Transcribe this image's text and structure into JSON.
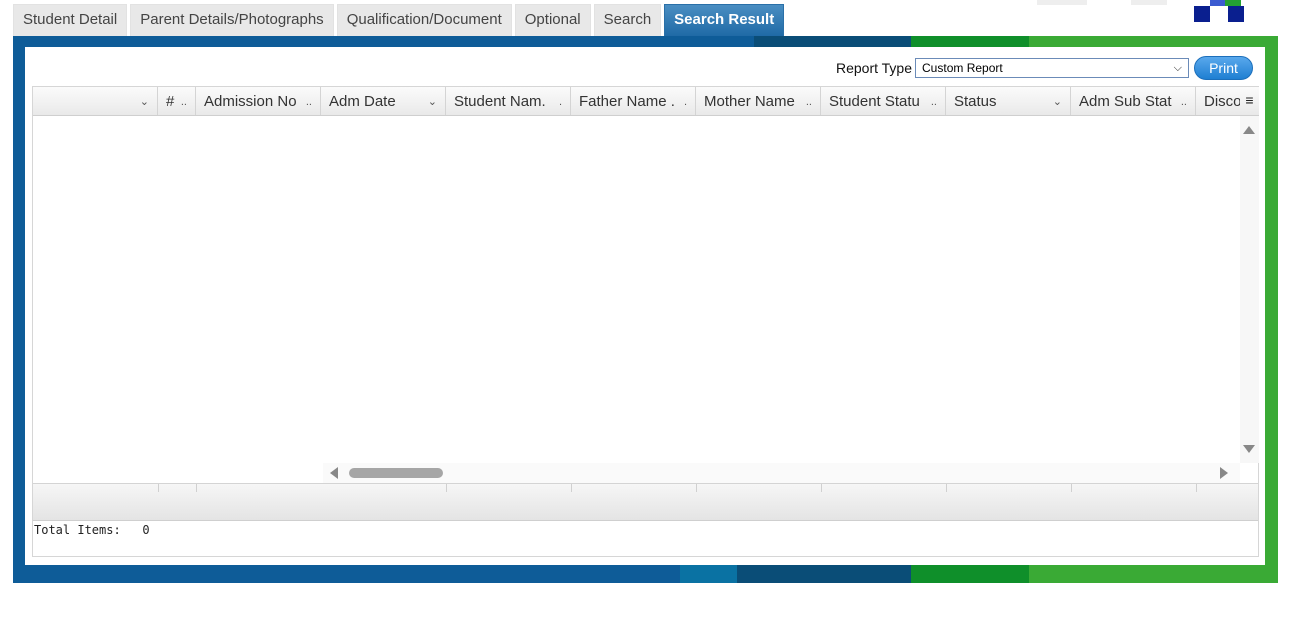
{
  "tabs": [
    {
      "label": "Student Detail",
      "active": false
    },
    {
      "label": "Parent Details/Photographs",
      "active": false
    },
    {
      "label": "Qualification/Document",
      "active": false
    },
    {
      "label": "Optional",
      "active": false
    },
    {
      "label": "Search",
      "active": false
    },
    {
      "label": "Search Result",
      "active": true
    }
  ],
  "report": {
    "label": "Report Type",
    "selected": "Custom Report",
    "print_label": "Print"
  },
  "grid": {
    "columns": [
      {
        "label": ""
      },
      {
        "label": "#"
      },
      {
        "label": "Admission No"
      },
      {
        "label": "Adm Date"
      },
      {
        "label": "Student Nam."
      },
      {
        "label": "Father Name ."
      },
      {
        "label": "Mother Name"
      },
      {
        "label": "Student Statu"
      },
      {
        "label": "Status"
      },
      {
        "label": "Adm Sub Stat"
      },
      {
        "label": "Disco"
      }
    ],
    "menu_icon": "hamburger-icon",
    "rows": []
  },
  "footer": {
    "total_label": "Total Items:",
    "total_value": "0"
  },
  "colors": {
    "frame_blue": "#0e5c98",
    "frame_green": "#3aaa35",
    "tab_active": "#1f6aa6",
    "print_button": "#2a88d8"
  }
}
